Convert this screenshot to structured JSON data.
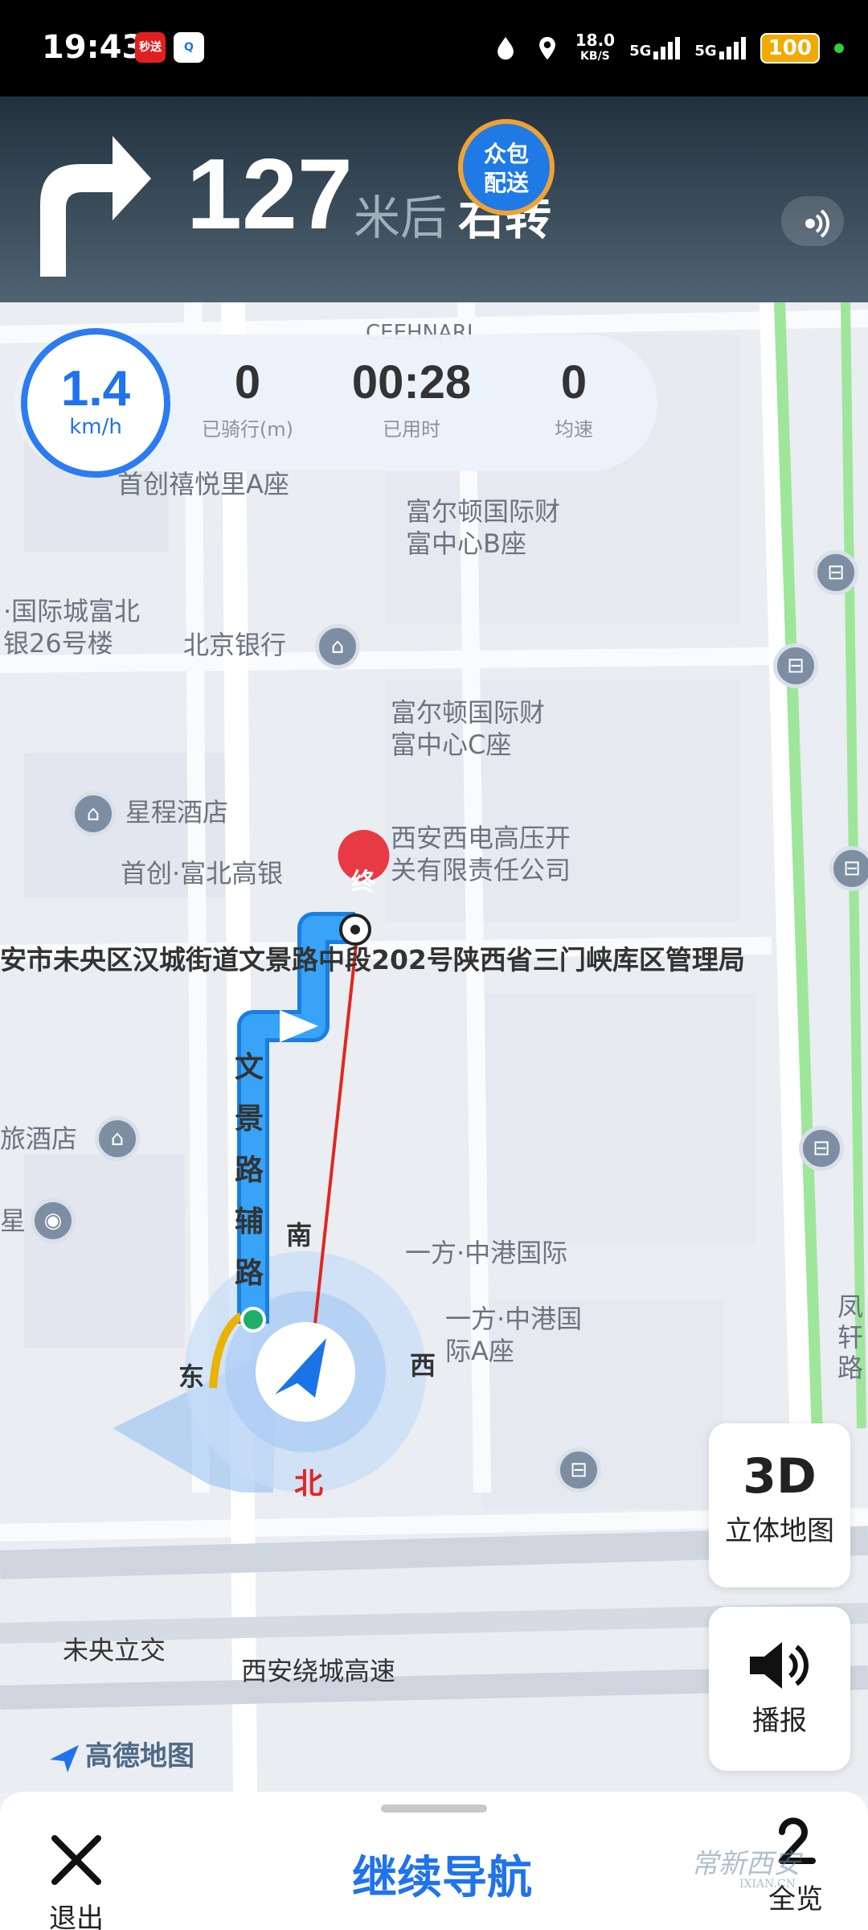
{
  "status_bar": {
    "time": "19:43",
    "app_badge_1": "秒送",
    "net_speed_value": "18.0",
    "net_speed_unit": "KB/S",
    "signal_1": "5G",
    "signal_2": "5G",
    "battery": "100",
    "icons": [
      "drop-icon",
      "location-pin-icon",
      "signal-icon",
      "battery-icon"
    ]
  },
  "turn": {
    "distance": "127",
    "unit": "米后",
    "action": "右转",
    "direction_icon": "turn-right-arrow-icon",
    "crowd_badge_line1": "众包",
    "crowd_badge_line2": "配送"
  },
  "stats": {
    "speed": "1.4",
    "speed_unit": "km/h",
    "ridden_value": "0",
    "ridden_label": "已骑行(m)",
    "time_value": "00:28",
    "time_label": "已用时",
    "avg_value": "0",
    "avg_label": "均速"
  },
  "map": {
    "top_partial": "CEEHNARI",
    "pois": {
      "shouchuang_a": "首创禧悦里A座",
      "fuerdun_b_1": "富尔顿国际财",
      "fuerdun_b_2": "富中心B座",
      "guoji_1": "·国际城富北",
      "guoji_2": "银26号楼",
      "bank": "北京银行",
      "fuerdun_c_1": "富尔顿国际财",
      "fuerdun_c_2": "富中心C座",
      "star_hotel": "星程酒店",
      "xidian_1": "西安西电高压开",
      "xidian_2": "关有限责任公司",
      "fubei": "首创·富北高银",
      "address": "安市未央区汉城街道文景路中段202号陕西省三门峡库区管理局",
      "road_vertical": "文景路辅路",
      "hotel_left": "旅酒店",
      "yifang_1": "一方·中港国际",
      "yifang_a_1": "一方·中港国",
      "yifang_a_2": "际A座",
      "fengxuan": "凤轩路",
      "weiyang": "未央立交",
      "ring_road": "西安绕城高速",
      "left_partial": "星"
    },
    "end_marker": "终",
    "compass": {
      "north": "北",
      "south": "南",
      "east": "东",
      "west": "西"
    },
    "brand": "高德地图"
  },
  "buttons": {
    "three_d_title": "3D",
    "three_d_label": "立体地图",
    "broadcast_label": "播报"
  },
  "bottom": {
    "exit_label": "退出",
    "continue_label": "继续导航",
    "overview_label": "全览",
    "watermark": "常新西安",
    "watermark_url": "IXIAN.CN"
  }
}
